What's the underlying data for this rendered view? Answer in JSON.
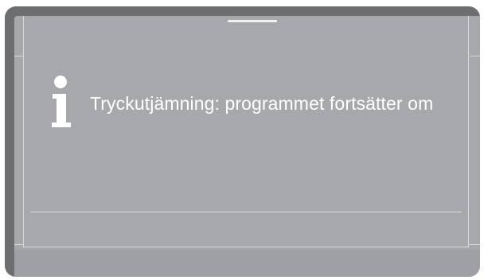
{
  "display": {
    "message": "Tryckutjämning: programmet fortsätter om"
  },
  "icons": {
    "status_icon": "info-icon"
  },
  "colors": {
    "bezel": "#6d6e70",
    "screen": "#a7a8ab",
    "text": "#ffffff",
    "lines": "#d9dadb"
  }
}
